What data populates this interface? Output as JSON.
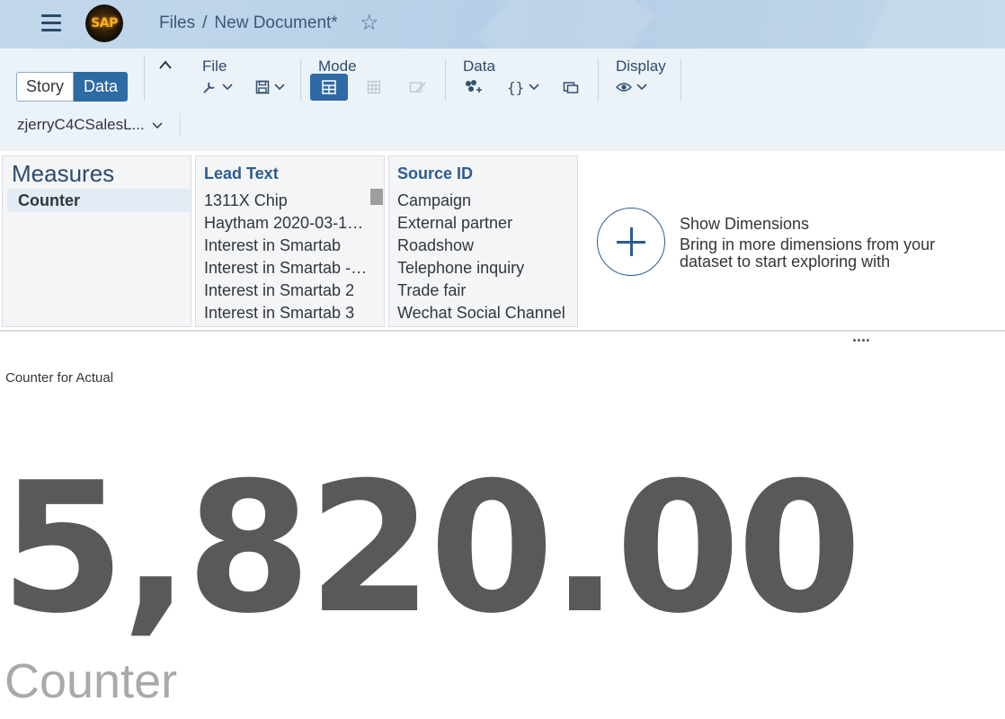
{
  "shell": {
    "logo_text": "SAP",
    "breadcrumb": {
      "root": "Files",
      "separator": "/",
      "document": "New Document*"
    }
  },
  "toolbar": {
    "view_toggle": {
      "story": "Story",
      "data": "Data"
    },
    "groups": {
      "file": "File",
      "mode": "Mode",
      "data": "Data",
      "display": "Display"
    },
    "model_name": "zjerryC4CSalesL..."
  },
  "measures": {
    "title": "Measures",
    "items": [
      "Counter"
    ]
  },
  "dimensions": [
    {
      "title": "Lead Text",
      "members": [
        "1311X Chip",
        "Haytham 2020-03-19...",
        "Interest in Smartab",
        "Interest in Smartab - ...",
        "Interest in Smartab 2",
        "Interest in Smartab 3"
      ]
    },
    {
      "title": "Source ID",
      "members": [
        "Campaign",
        "External partner",
        "Roadshow",
        "Telephone inquiry",
        "Trade fair",
        "Wechat Social Channel"
      ]
    }
  ],
  "show_dimensions": {
    "title": "Show Dimensions",
    "description": "Bring in more dimensions from your dataset to start exploring with"
  },
  "kpi": {
    "title": "Counter for Actual",
    "value": "5,820.00",
    "label": "Counter"
  },
  "more_label": "...."
}
